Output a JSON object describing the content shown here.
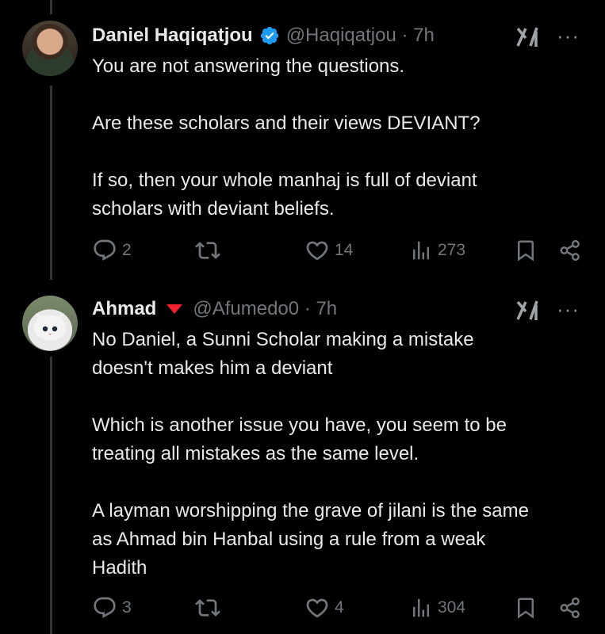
{
  "tweets": [
    {
      "name": "Daniel Haqiqatjou",
      "verified": true,
      "handle_time": "@Haqiqatjou · 7h",
      "lines": [
        "You are not answering the questions.",
        "",
        "Are these scholars and their views DEVIANT?",
        "",
        "If so, then your whole manhaj is full of deviant",
        "scholars with deviant beliefs."
      ],
      "replies": "2",
      "likes": "14",
      "views": "273"
    },
    {
      "name": "Ahmad",
      "verified": false,
      "handle_time": "@Afumedo0 · 7h",
      "lines": [
        "No Daniel, a Sunni Scholar making a mistake",
        "doesn't makes him a deviant",
        "",
        "Which is another issue you have, you seem to be",
        "treating all mistakes as the same level.",
        "",
        "A layman worshipping the grave of jilani is the same",
        "as Ahmad bin Hanbal using a rule from a weak",
        "Hadith"
      ],
      "replies": "3",
      "likes": "4",
      "views": "304"
    }
  ],
  "more_label": "···",
  "colors": {
    "background": "#000000",
    "text": "#e7e9ea",
    "muted": "#71767b",
    "verified": "#1d9bf0",
    "triangle": "#f4212e"
  }
}
